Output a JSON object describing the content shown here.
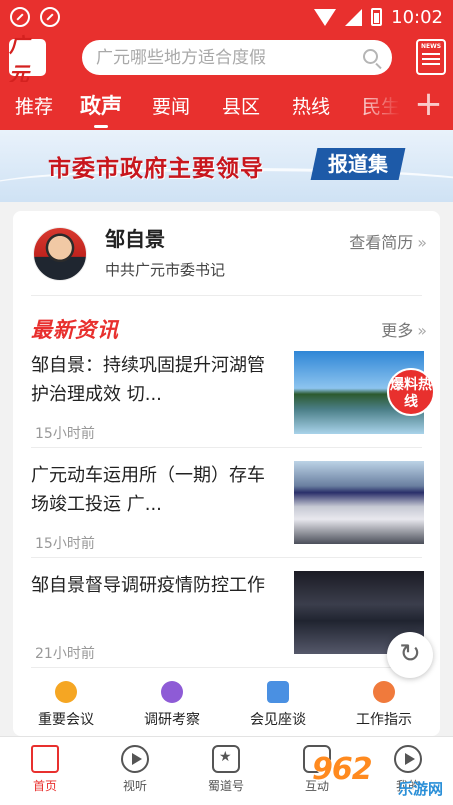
{
  "status": {
    "time": "10:02"
  },
  "header": {
    "logo_text": "广元",
    "search_placeholder": "广元哪些地方适合度假",
    "news_button": "NEWS"
  },
  "tabs": [
    {
      "label": "推荐"
    },
    {
      "label": "政声"
    },
    {
      "label": "要闻"
    },
    {
      "label": "县区"
    },
    {
      "label": "热线"
    },
    {
      "label": "民生"
    }
  ],
  "banner": {
    "title": "市委市政府主要领导",
    "badge": "报道集"
  },
  "leader": {
    "name": "邹自景",
    "role": "中共广元市委书记",
    "resume_link": "查看简历"
  },
  "latest": {
    "heading": "最新资讯",
    "more": "更多",
    "items": [
      {
        "title": "邹自景：持续巩固提升河湖管护治理成效 切...",
        "time": "15小时前"
      },
      {
        "title": "广元动车运用所（一期）存车场竣工投运 广...",
        "time": "15小时前"
      },
      {
        "title": "邹自景督导调研疫情防控工作",
        "time": "21小时前"
      }
    ]
  },
  "hot_badge": "爆料热线",
  "quick_links": [
    {
      "label": "重要会议",
      "color": "#f5a623"
    },
    {
      "label": "调研考察",
      "color": "#8e5bd6"
    },
    {
      "label": "会见座谈",
      "color": "#4a90e2"
    },
    {
      "label": "工作指示",
      "color": "#f07a3c"
    }
  ],
  "bottom_nav": [
    {
      "label": "首页"
    },
    {
      "label": "视听"
    },
    {
      "label": "蜀道号"
    },
    {
      "label": "互动"
    },
    {
      "label": "我的"
    }
  ],
  "watermark": {
    "text": "962",
    "sub": "乐游网"
  }
}
